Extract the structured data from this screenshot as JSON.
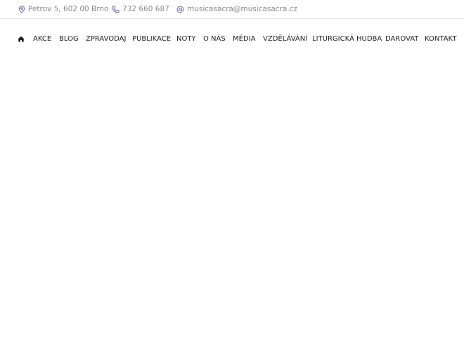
{
  "topbar": {
    "address": "Petrov 5, 602 00 Brno",
    "phone": "732 660 687",
    "email": "musicasacra@musicasacra.cz",
    "icons": [
      "map-pin-icon",
      "phone-icon",
      "at-sign-icon"
    ],
    "icon_color": "#6c5fa7"
  },
  "nav": {
    "home_icon": "home-icon",
    "items": [
      {
        "label": "AKCE"
      },
      {
        "label": "BLOG"
      },
      {
        "label": "ZPRAVODAJ"
      },
      {
        "label": "PUBLIKACE"
      },
      {
        "label": "NOTY"
      },
      {
        "label": "O NÁS"
      },
      {
        "label": "MÉDIA"
      },
      {
        "label": "VZDĚLÁVÁNÍ"
      },
      {
        "label": "LITURGICKÁ HUDBA"
      },
      {
        "label": "DAROVAT"
      },
      {
        "label": "KONTAKT"
      }
    ]
  }
}
